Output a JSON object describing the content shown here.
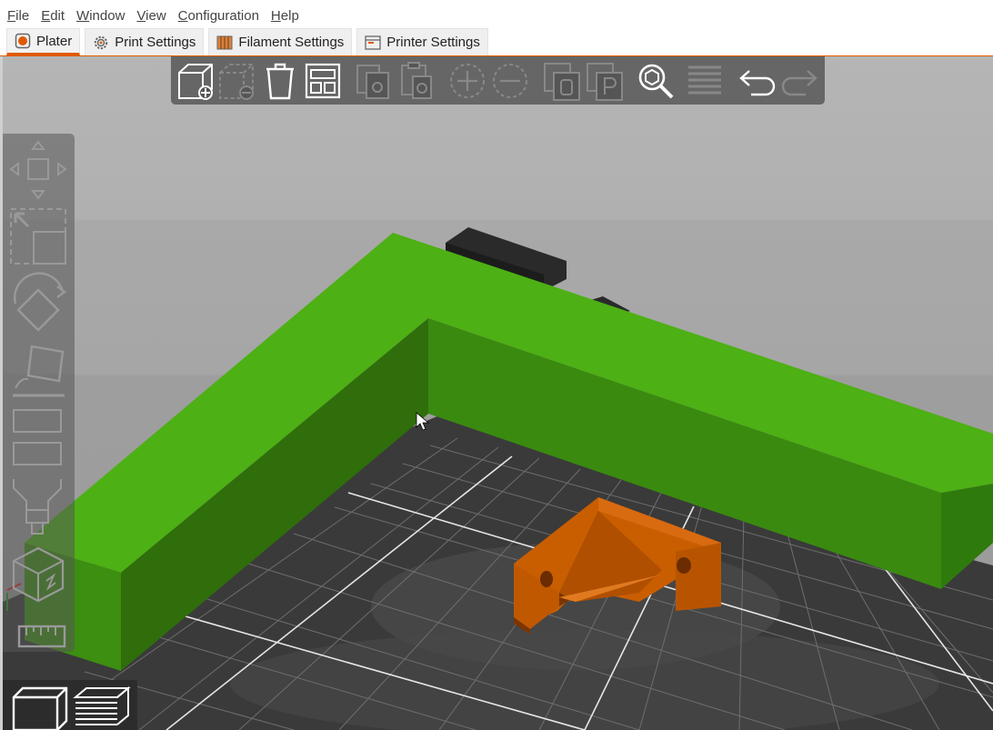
{
  "menu": [
    {
      "underline": "F",
      "rest": "ile"
    },
    {
      "underline": "E",
      "rest": "dit"
    },
    {
      "underline": "W",
      "rest": "indow"
    },
    {
      "underline": "V",
      "rest": "iew"
    },
    {
      "underline": "C",
      "rest": "onfiguration"
    },
    {
      "underline": "H",
      "rest": "elp"
    }
  ],
  "tabs": [
    {
      "label": "Plater",
      "icon": "plater-icon"
    },
    {
      "label": "Print Settings",
      "icon": "gear-icon"
    },
    {
      "label": "Filament Settings",
      "icon": "filament-spool-icon"
    },
    {
      "label": "Printer Settings",
      "icon": "printer-icon"
    }
  ],
  "active_tab": "Plater",
  "colors": {
    "accent": "#e05a00",
    "model_green": "#4caf14",
    "model_orange": "#c45a00",
    "bed": "#3a3a3a",
    "background_top": "#b4b4b4",
    "background_bottom": "#9f9f9f"
  },
  "top_toolbar": [
    "add-icon",
    "delete-icon",
    "delete-all-icon",
    "arrange-icon",
    "copy-icon",
    "paste-icon",
    "add-instance-icon",
    "remove-instance-icon",
    "split-to-objects-icon",
    "split-to-parts-icon",
    "search-icon",
    "layers-editing-icon",
    "undo-icon",
    "redo-icon"
  ],
  "left_toolbar": [
    "move-icon",
    "scale-icon",
    "rotate-icon",
    "place-on-face-icon",
    "cut-icon",
    "paint-support-icon",
    "seam-painting-icon",
    "measure-icon"
  ],
  "view_switch": [
    "3d-view-icon",
    "preview-layers-icon"
  ]
}
